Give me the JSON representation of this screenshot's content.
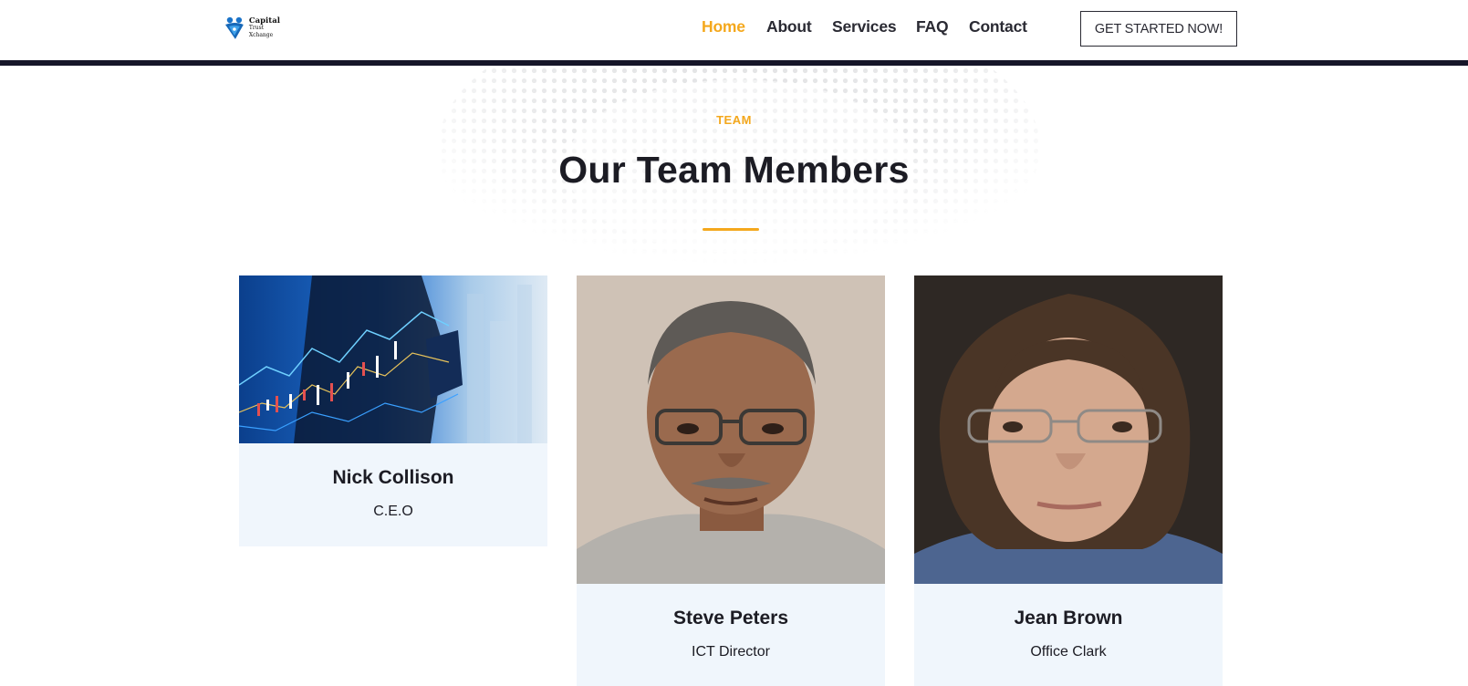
{
  "brand": {
    "logo_line1": "Capital",
    "logo_line2": "Trust Xchange",
    "accent": "#f4a81d",
    "dark": "#161629",
    "card_bg": "#f0f6fc"
  },
  "nav": {
    "items": [
      {
        "label": "Home",
        "active": true
      },
      {
        "label": "About",
        "active": false
      },
      {
        "label": "Services",
        "active": false
      },
      {
        "label": "FAQ",
        "active": false
      },
      {
        "label": "Contact",
        "active": false
      }
    ],
    "cta_label": "GET STARTED NOW!"
  },
  "team": {
    "eyebrow": "TEAM",
    "title": "Our Team Members",
    "members": [
      {
        "name": "Nick Collison",
        "role": "C.E.O",
        "photo": "stock-market-chart-photo"
      },
      {
        "name": "Steve Peters",
        "role": "ICT Director",
        "photo": "man-with-glasses-portrait"
      },
      {
        "name": "Jean Brown",
        "role": "Office Clark",
        "photo": "woman-with-glasses-portrait"
      }
    ]
  }
}
